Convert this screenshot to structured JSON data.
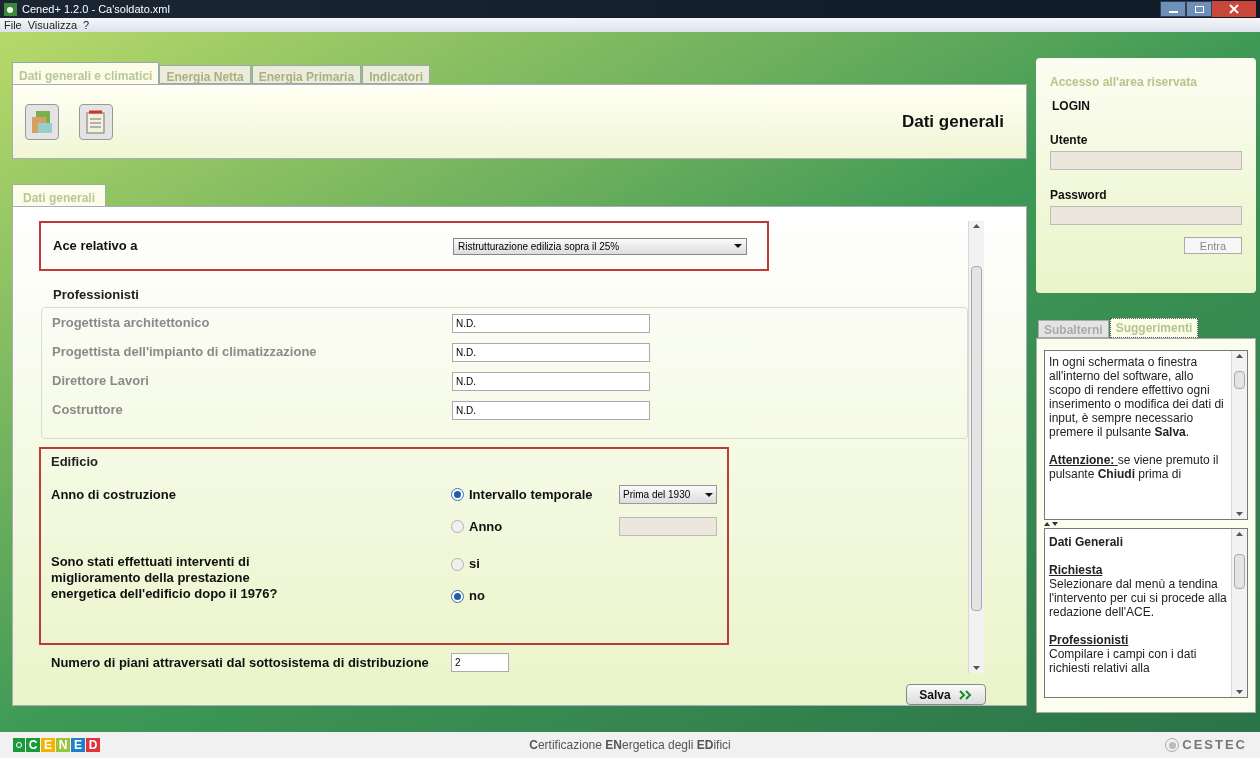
{
  "window": {
    "title": "Cened+ 1.2.0 - Ca'soldato.xml"
  },
  "menu": [
    "File",
    "Visualizza",
    "?"
  ],
  "main_tabs": [
    {
      "label": "Dati generali e climatici",
      "selected": true
    },
    {
      "label": "Energia Netta",
      "selected": false
    },
    {
      "label": "Energia Primaria",
      "selected": false
    },
    {
      "label": "Indicatori",
      "selected": false
    }
  ],
  "section_title": "Dati generali",
  "sub_tabs": [
    {
      "label": "Dati generali",
      "selected": true
    }
  ],
  "ace": {
    "label": "Ace relativo a",
    "value": "Ristrutturazione edilizia sopra il 25%"
  },
  "professionisti": {
    "title": "Professionisti",
    "fields": [
      {
        "label": "Progettista architettonico",
        "value": "N.D."
      },
      {
        "label": "Progettista dell'impianto di climatizzazione",
        "value": "N.D."
      },
      {
        "label": "Direttore Lavori",
        "value": "N.D."
      },
      {
        "label": "Costruttore",
        "value": "N.D."
      }
    ]
  },
  "edificio": {
    "title": "Edificio",
    "anno": {
      "label": "Anno di costruzione",
      "options": [
        {
          "label": "Intervallo temporale",
          "selected": true,
          "kind": "select",
          "value": "Prima del 1930"
        },
        {
          "label": "Anno",
          "selected": false,
          "kind": "input"
        }
      ]
    },
    "interventi": {
      "label": "Sono stati effettuati interventi di miglioramento della prestazione energetica dell'edificio dopo il 1976?",
      "options": [
        {
          "label": "si",
          "selected": false
        },
        {
          "label": "no",
          "selected": true
        }
      ]
    }
  },
  "piani": {
    "label": "Numero di piani attraversati dal sottosistema di distribuzione",
    "value": "2"
  },
  "save_button": "Salva",
  "login": {
    "title": "Accesso all'area riservata",
    "heading": "LOGIN",
    "user_label": "Utente",
    "password_label": "Password",
    "button": "Entra"
  },
  "side_tabs": [
    {
      "label": "Subalterni",
      "selected": false
    },
    {
      "label": "Suggerimenti",
      "selected": true
    }
  ],
  "hint_top": [
    {
      "text": "In ogni schermata o finestra all'interno del software, allo scopo di rendere effettivo ogni inserimento o modifica dei dati di input, è sempre necessario premere il pulsante **Salva**."
    },
    {
      "heading": "Attenzione:",
      "text": "se viene premuto il pulsante **Chiudi** prima di"
    }
  ],
  "hint_bottom": {
    "title": "Dati Generali",
    "sections": [
      {
        "heading": "Richiesta",
        "text": "Selezionare dal menù a tendina l'intervento per cui si procede alla redazione dell'ACE."
      },
      {
        "heading": "Professionisti",
        "text": "Compilare i campi con i dati richiesti relativi alla"
      }
    ]
  },
  "footer": {
    "logo_left": [
      "C",
      "E",
      "N",
      "E",
      "D"
    ],
    "tagline": "**C**ertificazione **EN**ergetica degli **ED**ifici",
    "logo_right": "CESTEC"
  }
}
